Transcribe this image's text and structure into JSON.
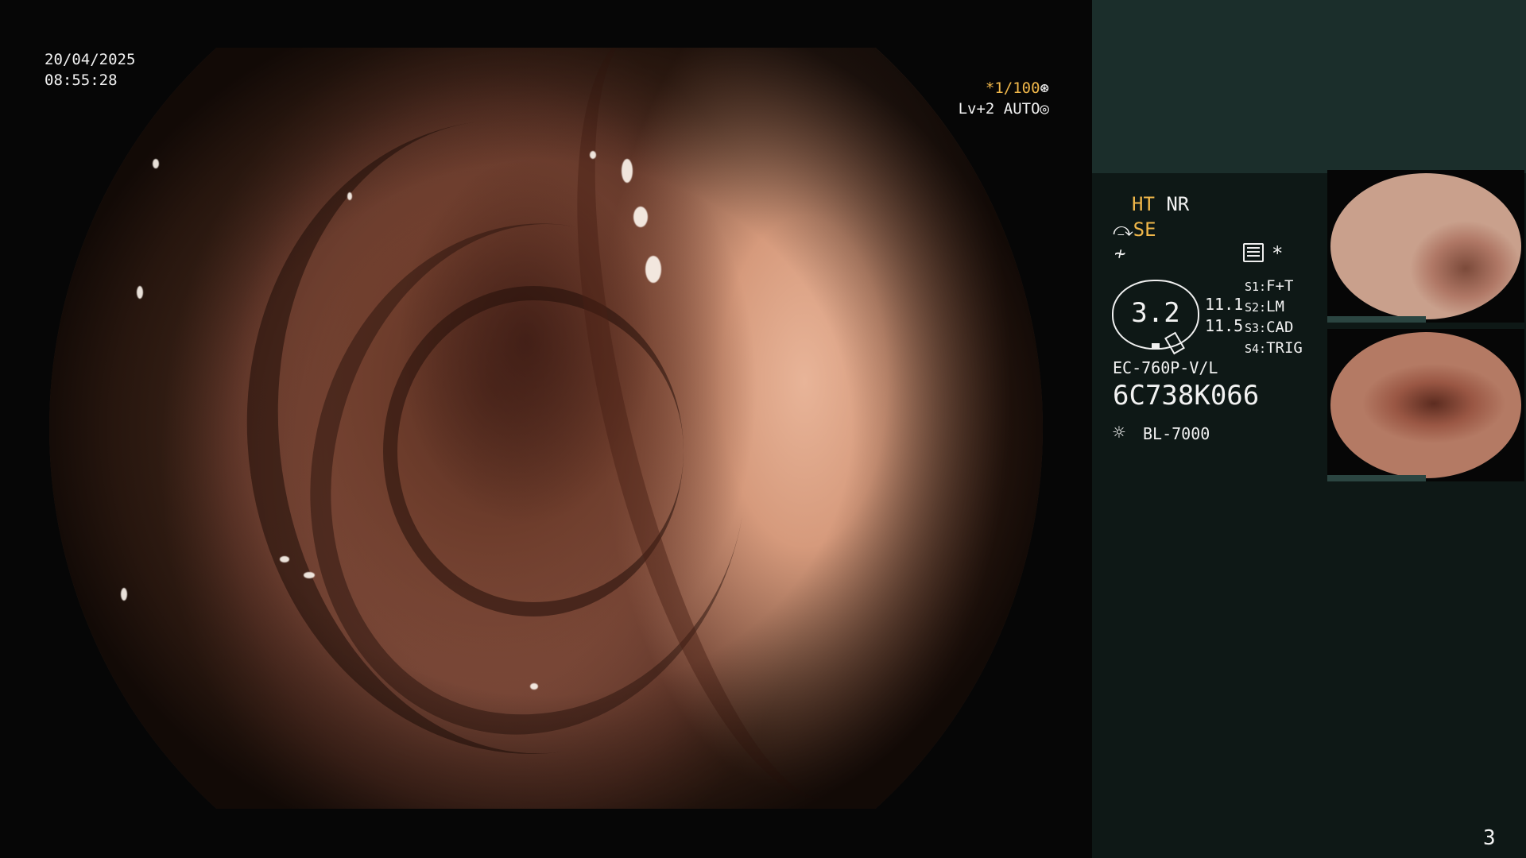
{
  "live_view": {
    "date": "20/04/2025",
    "time": "08:55:28",
    "shutter": "*1/100",
    "shutter_icon": "aperture-icon",
    "brightness": "Lv+2 AUTO",
    "brightness_icon": "brightness-icon"
  },
  "panel": {
    "ht": "HT",
    "nr": "NR",
    "se": "SE",
    "se_icon": "structure-enhance-icon",
    "color_icon": "color-mode-icon",
    "memo_icon": "memo-icon",
    "star": "*",
    "zoom": "3.2",
    "zoom_sub1": "11.1",
    "zoom_sub2": "11.5",
    "switches": [
      {
        "key": "S1:",
        "value": "F+T"
      },
      {
        "key": "S2:",
        "value": "LM"
      },
      {
        "key": "S3:",
        "value": "CAD"
      },
      {
        "key": "S4:",
        "value": "TRIG"
      }
    ],
    "scope_model": "EC-760P-V/L",
    "serial": "6C738K066",
    "lamp_icon": "light-source-icon",
    "lamp": "BL-7000"
  },
  "page_number": "3",
  "colors": {
    "accent": "#f0b74a",
    "panel_bg": "#0e1816",
    "panel_band": "#1b2e2b"
  }
}
